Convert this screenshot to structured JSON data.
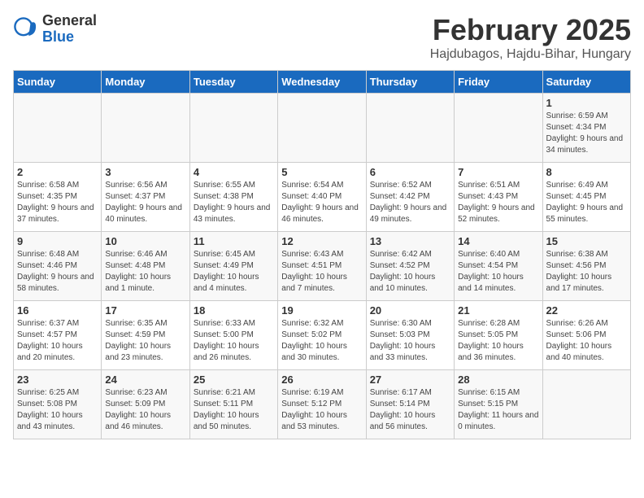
{
  "header": {
    "logo_general": "General",
    "logo_blue": "Blue",
    "month_title": "February 2025",
    "location": "Hajdubagos, Hajdu-Bihar, Hungary"
  },
  "weekdays": [
    "Sunday",
    "Monday",
    "Tuesday",
    "Wednesday",
    "Thursday",
    "Friday",
    "Saturday"
  ],
  "weeks": [
    [
      {
        "day": "",
        "info": ""
      },
      {
        "day": "",
        "info": ""
      },
      {
        "day": "",
        "info": ""
      },
      {
        "day": "",
        "info": ""
      },
      {
        "day": "",
        "info": ""
      },
      {
        "day": "",
        "info": ""
      },
      {
        "day": "1",
        "info": "Sunrise: 6:59 AM\nSunset: 4:34 PM\nDaylight: 9 hours and 34 minutes."
      }
    ],
    [
      {
        "day": "2",
        "info": "Sunrise: 6:58 AM\nSunset: 4:35 PM\nDaylight: 9 hours and 37 minutes."
      },
      {
        "day": "3",
        "info": "Sunrise: 6:56 AM\nSunset: 4:37 PM\nDaylight: 9 hours and 40 minutes."
      },
      {
        "day": "4",
        "info": "Sunrise: 6:55 AM\nSunset: 4:38 PM\nDaylight: 9 hours and 43 minutes."
      },
      {
        "day": "5",
        "info": "Sunrise: 6:54 AM\nSunset: 4:40 PM\nDaylight: 9 hours and 46 minutes."
      },
      {
        "day": "6",
        "info": "Sunrise: 6:52 AM\nSunset: 4:42 PM\nDaylight: 9 hours and 49 minutes."
      },
      {
        "day": "7",
        "info": "Sunrise: 6:51 AM\nSunset: 4:43 PM\nDaylight: 9 hours and 52 minutes."
      },
      {
        "day": "8",
        "info": "Sunrise: 6:49 AM\nSunset: 4:45 PM\nDaylight: 9 hours and 55 minutes."
      }
    ],
    [
      {
        "day": "9",
        "info": "Sunrise: 6:48 AM\nSunset: 4:46 PM\nDaylight: 9 hours and 58 minutes."
      },
      {
        "day": "10",
        "info": "Sunrise: 6:46 AM\nSunset: 4:48 PM\nDaylight: 10 hours and 1 minute."
      },
      {
        "day": "11",
        "info": "Sunrise: 6:45 AM\nSunset: 4:49 PM\nDaylight: 10 hours and 4 minutes."
      },
      {
        "day": "12",
        "info": "Sunrise: 6:43 AM\nSunset: 4:51 PM\nDaylight: 10 hours and 7 minutes."
      },
      {
        "day": "13",
        "info": "Sunrise: 6:42 AM\nSunset: 4:52 PM\nDaylight: 10 hours and 10 minutes."
      },
      {
        "day": "14",
        "info": "Sunrise: 6:40 AM\nSunset: 4:54 PM\nDaylight: 10 hours and 14 minutes."
      },
      {
        "day": "15",
        "info": "Sunrise: 6:38 AM\nSunset: 4:56 PM\nDaylight: 10 hours and 17 minutes."
      }
    ],
    [
      {
        "day": "16",
        "info": "Sunrise: 6:37 AM\nSunset: 4:57 PM\nDaylight: 10 hours and 20 minutes."
      },
      {
        "day": "17",
        "info": "Sunrise: 6:35 AM\nSunset: 4:59 PM\nDaylight: 10 hours and 23 minutes."
      },
      {
        "day": "18",
        "info": "Sunrise: 6:33 AM\nSunset: 5:00 PM\nDaylight: 10 hours and 26 minutes."
      },
      {
        "day": "19",
        "info": "Sunrise: 6:32 AM\nSunset: 5:02 PM\nDaylight: 10 hours and 30 minutes."
      },
      {
        "day": "20",
        "info": "Sunrise: 6:30 AM\nSunset: 5:03 PM\nDaylight: 10 hours and 33 minutes."
      },
      {
        "day": "21",
        "info": "Sunrise: 6:28 AM\nSunset: 5:05 PM\nDaylight: 10 hours and 36 minutes."
      },
      {
        "day": "22",
        "info": "Sunrise: 6:26 AM\nSunset: 5:06 PM\nDaylight: 10 hours and 40 minutes."
      }
    ],
    [
      {
        "day": "23",
        "info": "Sunrise: 6:25 AM\nSunset: 5:08 PM\nDaylight: 10 hours and 43 minutes."
      },
      {
        "day": "24",
        "info": "Sunrise: 6:23 AM\nSunset: 5:09 PM\nDaylight: 10 hours and 46 minutes."
      },
      {
        "day": "25",
        "info": "Sunrise: 6:21 AM\nSunset: 5:11 PM\nDaylight: 10 hours and 50 minutes."
      },
      {
        "day": "26",
        "info": "Sunrise: 6:19 AM\nSunset: 5:12 PM\nDaylight: 10 hours and 53 minutes."
      },
      {
        "day": "27",
        "info": "Sunrise: 6:17 AM\nSunset: 5:14 PM\nDaylight: 10 hours and 56 minutes."
      },
      {
        "day": "28",
        "info": "Sunrise: 6:15 AM\nSunset: 5:15 PM\nDaylight: 11 hours and 0 minutes."
      },
      {
        "day": "",
        "info": ""
      }
    ]
  ]
}
